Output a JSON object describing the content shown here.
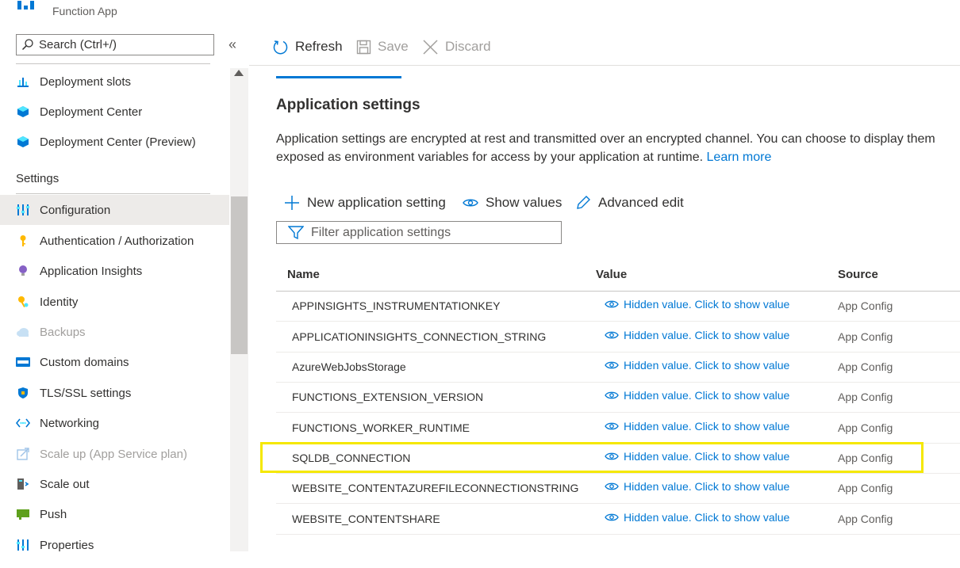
{
  "header": {
    "subtitle": "Function App"
  },
  "search": {
    "placeholder": "Search (Ctrl+/)"
  },
  "sidebar": {
    "items_top": [
      {
        "label": "Deployment slots",
        "icon": "deployment-slots-icon"
      },
      {
        "label": "Deployment Center",
        "icon": "deployment-center-icon"
      },
      {
        "label": "Deployment Center (Preview)",
        "icon": "deployment-center-icon"
      }
    ],
    "section_title": "Settings",
    "items": [
      {
        "label": "Configuration",
        "icon": "configuration-icon",
        "selected": true
      },
      {
        "label": "Authentication / Authorization",
        "icon": "key-icon"
      },
      {
        "label": "Application Insights",
        "icon": "lightbulb-icon"
      },
      {
        "label": "Identity",
        "icon": "identity-key-icon"
      },
      {
        "label": "Backups",
        "icon": "cloud-icon",
        "disabled": true
      },
      {
        "label": "Custom domains",
        "icon": "www-icon"
      },
      {
        "label": "TLS/SSL settings",
        "icon": "shield-icon"
      },
      {
        "label": "Networking",
        "icon": "networking-icon"
      },
      {
        "label": "Scale up (App Service plan)",
        "icon": "scale-up-icon",
        "disabled": true
      },
      {
        "label": "Scale out",
        "icon": "scale-out-icon"
      },
      {
        "label": "Push",
        "icon": "push-icon"
      },
      {
        "label": "Properties",
        "icon": "properties-icon"
      }
    ]
  },
  "toolbar": {
    "refresh": "Refresh",
    "save": "Save",
    "discard": "Discard"
  },
  "content": {
    "title": "Application settings",
    "description_line1": "Application settings are encrypted at rest and transmitted over an encrypted channel. You can choose to display them",
    "description_line2": "exposed as environment variables for access by your application at runtime.",
    "learn_more": "Learn more",
    "commands": {
      "new": "New application setting",
      "show": "Show values",
      "advanced": "Advanced edit"
    },
    "filter_placeholder": "Filter application settings",
    "columns": {
      "name": "Name",
      "value": "Value",
      "source": "Source"
    },
    "rows": [
      {
        "name": "APPINSIGHTS_INSTRUMENTATIONKEY",
        "value": "Hidden value. Click to show value",
        "source": "App Config"
      },
      {
        "name": "APPLICATIONINSIGHTS_CONNECTION_STRING",
        "value": "Hidden value. Click to show value",
        "source": "App Config"
      },
      {
        "name": "AzureWebJobsStorage",
        "value": "Hidden value. Click to show value",
        "source": "App Config"
      },
      {
        "name": "FUNCTIONS_EXTENSION_VERSION",
        "value": "Hidden value. Click to show value",
        "source": "App Config"
      },
      {
        "name": "FUNCTIONS_WORKER_RUNTIME",
        "value": "Hidden value. Click to show value",
        "source": "App Config"
      },
      {
        "name": "SQLDB_CONNECTION",
        "value": "Hidden value. Click to show value",
        "source": "App Config"
      },
      {
        "name": "WEBSITE_CONTENTAZUREFILECONNECTIONSTRING",
        "value": "Hidden value. Click to show value",
        "source": "App Config"
      },
      {
        "name": "WEBSITE_CONTENTSHARE",
        "value": "Hidden value. Click to show value",
        "source": "App Config"
      }
    ],
    "highlighted_row": "SQLDB_CONNECTION"
  },
  "colors": {
    "accent": "#0078d4",
    "highlight": "#f5e800",
    "selected_bg": "#edebe9"
  }
}
